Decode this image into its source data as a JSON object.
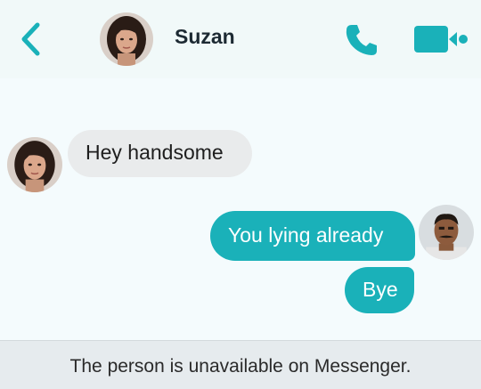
{
  "header": {
    "contact_name": "Suzan",
    "back_icon": "chevron-left-icon",
    "call_icon": "phone-icon",
    "video_icon": "video-camera-icon"
  },
  "messages": [
    {
      "direction": "incoming",
      "text": "Hey handsome"
    },
    {
      "direction": "outgoing",
      "text": "You lying already"
    },
    {
      "direction": "outgoing",
      "text": "Bye"
    }
  ],
  "footer": {
    "notice": "The person is unavailable on Messenger."
  },
  "colors": {
    "accent": "#1ab1b9",
    "incoming_bubble": "#e9ebec",
    "header_bg": "#f1f9f9",
    "chat_bg": "#f4fbfd",
    "footer_bg": "#e6ebee"
  }
}
